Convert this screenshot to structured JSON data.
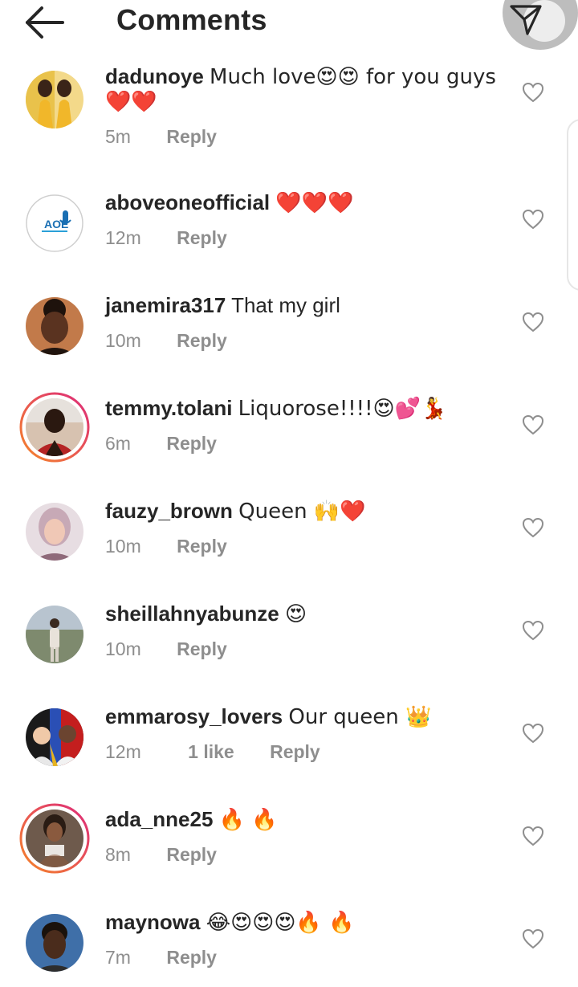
{
  "header": {
    "title": "Comments"
  },
  "comments": [
    {
      "user": "dadunoye",
      "text": "Much love😍😍 for you guys",
      "text2": "❤️❤️",
      "time": "5m",
      "reply": "Reply",
      "likes": ""
    },
    {
      "user": "aboveoneofficial",
      "text": "❤️❤️❤️",
      "time": "12m",
      "reply": "Reply",
      "likes": "",
      "avatar_text": "AOE"
    },
    {
      "user": "janemira317",
      "text": "That my girl",
      "time": "10m",
      "reply": "Reply",
      "likes": ""
    },
    {
      "user": "temmy.tolani",
      "text": "Liquorose!!!!😍💕💃",
      "time": "6m",
      "reply": "Reply",
      "likes": ""
    },
    {
      "user": "fauzy_brown",
      "text": "Queen 🙌❤️",
      "time": "10m",
      "reply": "Reply",
      "likes": ""
    },
    {
      "user": "sheillahnyabunze",
      "text": "😍",
      "time": "10m",
      "reply": "Reply",
      "likes": ""
    },
    {
      "user": "emmarosy_lovers",
      "text": "Our queen 👑",
      "time": "12m",
      "reply": "Reply",
      "likes": "1 like"
    },
    {
      "user": "ada_nne25",
      "text": "🔥 🔥",
      "time": "8m",
      "reply": "Reply",
      "likes": ""
    },
    {
      "user": "maynowa",
      "text": "😂😍😍😍🔥 🔥",
      "time": "7m",
      "reply": "Reply",
      "likes": ""
    }
  ],
  "colors": {
    "heart": "#e0312f",
    "muted": "#8e8e8e",
    "story_ring_start": "#f58529",
    "story_ring_end": "#dd2a7b"
  },
  "icons": {
    "back": "back-arrow-icon",
    "share": "paper-plane-icon",
    "like": "heart-outline-icon"
  }
}
